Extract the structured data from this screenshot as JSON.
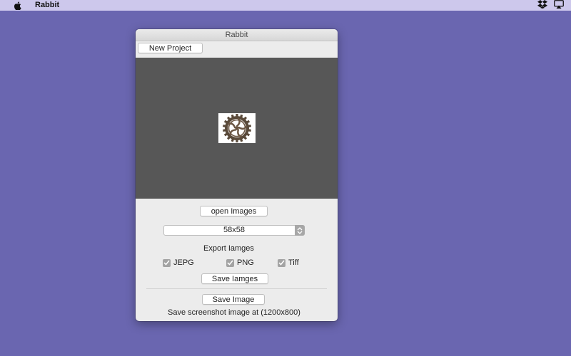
{
  "menubar": {
    "app_name": "Rabbit"
  },
  "window": {
    "title": "Rabbit",
    "new_project_label": "New Project",
    "open_images_label": "open Images",
    "size_select": {
      "value": "58x58"
    },
    "export_heading": "Export Iamges",
    "formats": [
      {
        "label": "JEPG",
        "checked": true
      },
      {
        "label": "PNG",
        "checked": true
      },
      {
        "label": "Tiff",
        "checked": true
      }
    ],
    "save_images_label": "Save Iamges",
    "save_image_label": "Save Image",
    "screenshot_note": "Save screenshot image at (1200x800)"
  },
  "colors": {
    "desktop": "#6a66b0",
    "menubar": "#cdc8ec",
    "canvas": "#575757"
  },
  "icons": [
    "apple-icon",
    "dropbox-icon",
    "airplay-icon",
    "gear-icon",
    "check-icon",
    "chevron-updown-icon"
  ]
}
